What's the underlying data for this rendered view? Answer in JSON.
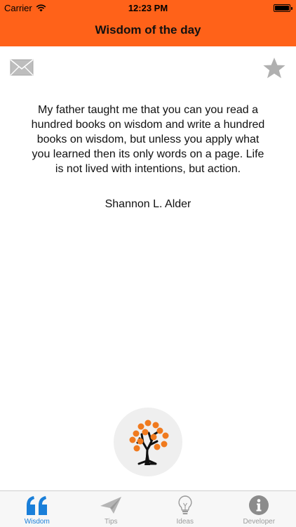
{
  "status_bar": {
    "carrier": "Carrier",
    "time": "12:23 PM"
  },
  "nav": {
    "title": "Wisdom of the day"
  },
  "actions": {
    "mail_icon": "envelope-icon",
    "favorite_icon": "star-icon"
  },
  "quote": {
    "text": "My father taught me that you can you read a hundred books on wisdom and write a hundred books on wisdom, but unless you apply what you learned then its only words on a page. Life is not lived with intentions, but action.",
    "author": "Shannon L. Alder"
  },
  "tree_button": {
    "icon": "tree-icon"
  },
  "tabs": [
    {
      "label": "Wisdom",
      "icon": "quote-icon",
      "active": true
    },
    {
      "label": "Tips",
      "icon": "paper-plane-icon",
      "active": false
    },
    {
      "label": "Ideas",
      "icon": "lightbulb-icon",
      "active": false
    },
    {
      "label": "Developer",
      "icon": "info-icon",
      "active": false
    }
  ],
  "colors": {
    "nav_orange": "#ff6219",
    "tab_active": "#1a7fd9",
    "tab_inactive": "#9b9b9b",
    "icon_gray": "#b5b5b5"
  }
}
